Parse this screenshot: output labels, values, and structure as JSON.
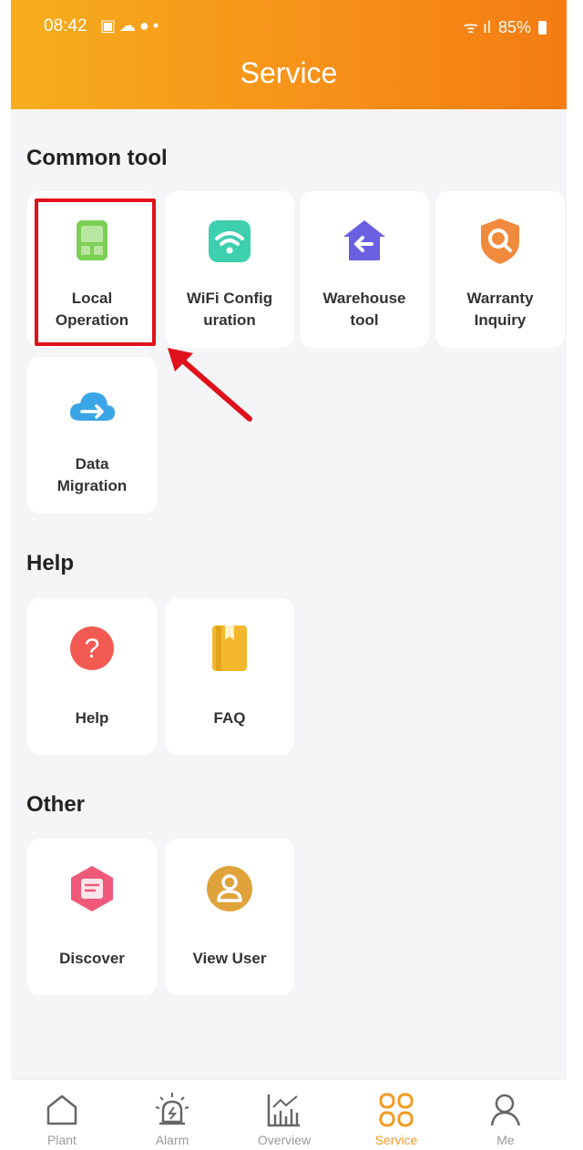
{
  "statusbar": {
    "time": "08:42",
    "battery": "85%"
  },
  "header": {
    "title": "Service"
  },
  "sections": {
    "common": {
      "title": "Common tool",
      "items": [
        {
          "label": "Local\nOperation"
        },
        {
          "label": "WiFi Config\nuration"
        },
        {
          "label": "Warehouse\ntool"
        },
        {
          "label": "Warranty\nInquiry"
        },
        {
          "label": "Data\nMigration"
        }
      ]
    },
    "help": {
      "title": "Help",
      "items": [
        {
          "label": "Help"
        },
        {
          "label": "FAQ"
        }
      ]
    },
    "other": {
      "title": "Other",
      "items": [
        {
          "label": "Discover"
        },
        {
          "label": "View User"
        }
      ]
    }
  },
  "bottom_nav": {
    "items": [
      {
        "label": "Plant",
        "icon": "home-icon"
      },
      {
        "label": "Alarm",
        "icon": "alarm-icon"
      },
      {
        "label": "Overview",
        "icon": "chart-icon"
      },
      {
        "label": "Service",
        "icon": "service-grid-icon"
      },
      {
        "label": "Me",
        "icon": "person-icon"
      }
    ],
    "active": "Service"
  },
  "colors": {
    "accent": "#f39b24",
    "highlight": "#e0111c"
  }
}
